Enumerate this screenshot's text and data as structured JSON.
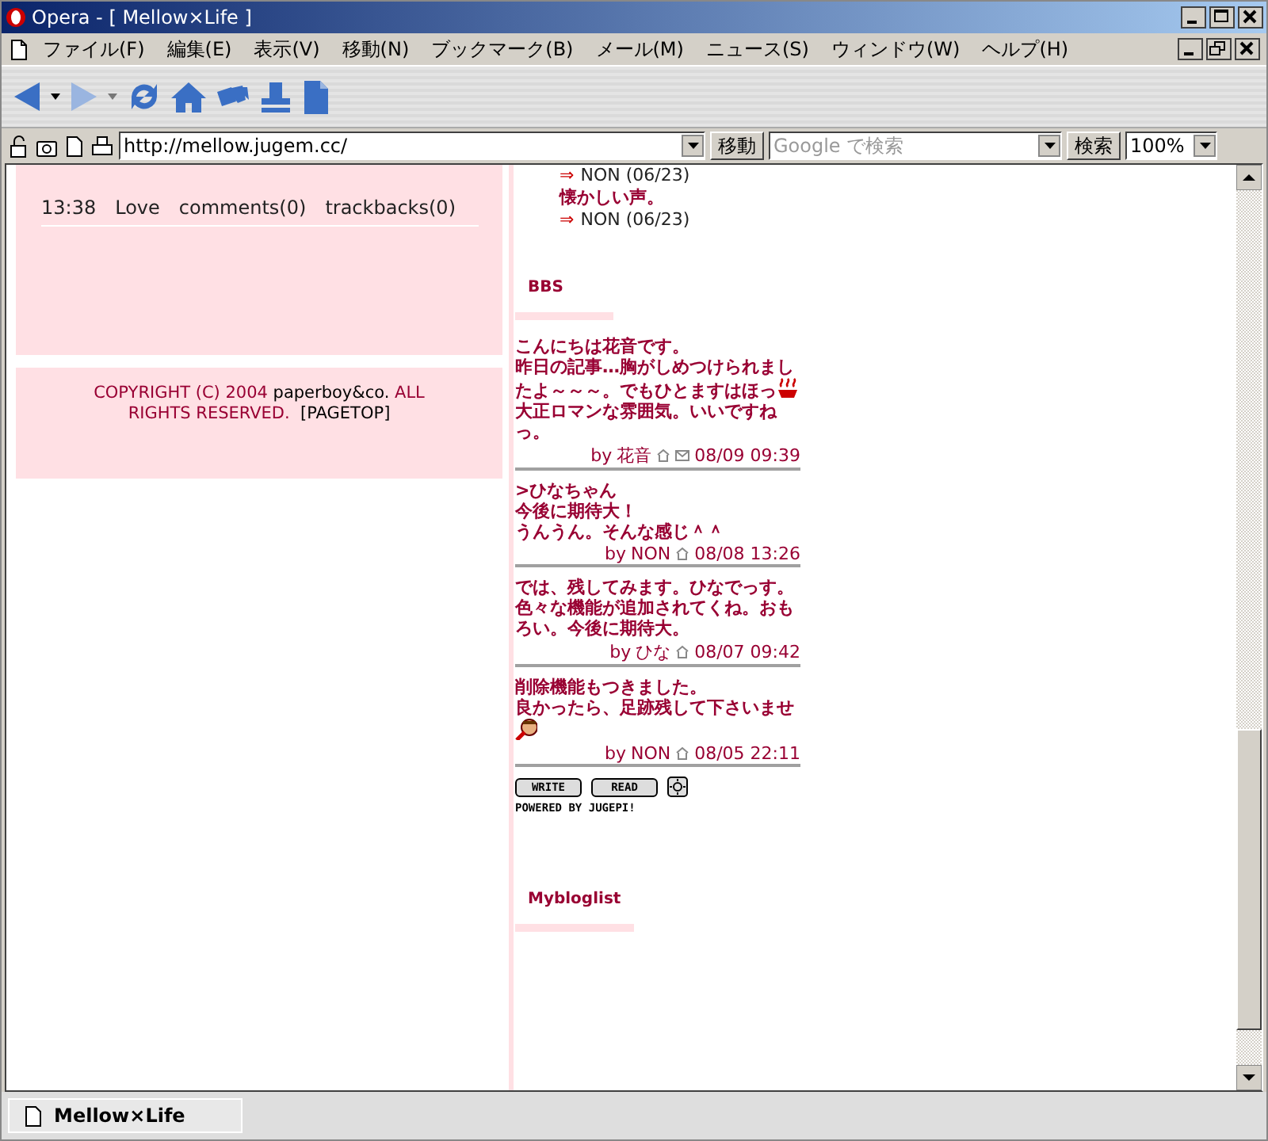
{
  "window": {
    "title": "Opera - [ Mellow×Life ]"
  },
  "menu": [
    "ファイル(F)",
    "編集(E)",
    "表示(V)",
    "移動(N)",
    "ブックマーク(B)",
    "メール(M)",
    "ニュース(S)",
    "ウィンドウ(W)",
    "ヘルプ(H)"
  ],
  "address_bar": {
    "url": "http://mellow.jugem.cc/",
    "go_button": "移動",
    "search_placeholder": "Google で検索",
    "search_button": "検索",
    "zoom": "100%"
  },
  "entry_footer": {
    "time": "13:38",
    "category": "Love",
    "comments": "comments(0)",
    "trackbacks": "trackbacks(0)"
  },
  "copyright": {
    "text": "COPYRIGHT (C) 2004",
    "link": "paperboy&co.",
    "text_after": "ALL RIGHTS RESERVED.",
    "pagetop": "[PAGETOP]"
  },
  "recent_comments": [
    {
      "kind": "reply",
      "arrow": "⇒",
      "text": "NON (06/23)"
    },
    {
      "kind": "quote",
      "text": "懐かしい声。"
    },
    {
      "kind": "reply",
      "arrow": "⇒",
      "text": "NON (06/23)"
    }
  ],
  "bbs": {
    "title": "BBS",
    "posts": [
      {
        "paragraphs": [
          {
            "text": "こんにちは花音です。",
            "emoticon": false
          },
          {
            "text": "昨日の記事…胸がしめつけられましたよ～～～。でもひとますはほっ",
            "emoticon": true
          },
          {
            "text": "大正ロマンな雰囲気。いいですねっ。",
            "emoticon": false
          }
        ],
        "by": "by",
        "author": "花音",
        "home": true,
        "mail": true,
        "date": "08/09 09:39"
      },
      {
        "paragraphs": [
          {
            "text": ">ひなちゃん",
            "emoticon": false
          },
          {
            "text": "今後に期待大！",
            "emoticon": false
          },
          {
            "text": "うんうん。そんな感じ＾＾",
            "emoticon": false
          }
        ],
        "by": "by",
        "author": "NON",
        "home": true,
        "mail": false,
        "date": "08/08 13:26"
      },
      {
        "paragraphs": [
          {
            "text": "では、残してみます。ひなでっす。",
            "emoticon": false
          },
          {
            "text": "色々な機能が追加されてくね。おもろい。今後に期待大。",
            "emoticon": false
          }
        ],
        "by": "by",
        "author": "ひな",
        "home": true,
        "mail": false,
        "date": "08/07 09:42"
      },
      {
        "paragraphs": [
          {
            "text": "削除機能もつきました。",
            "emoticon": false
          },
          {
            "text": "良かったら、足跡残して下さいませ",
            "emoticon": true
          }
        ],
        "by": "by",
        "author": "NON",
        "home": true,
        "mail": false,
        "date": "08/05 22:11"
      }
    ],
    "buttons": [
      "WRITE",
      "READ"
    ],
    "powered": "POWERED BY JUGEPI!"
  },
  "sidebar_heading": "Mybloglist",
  "tabs": [
    {
      "title": "Mellow×Life",
      "selected": true
    }
  ]
}
